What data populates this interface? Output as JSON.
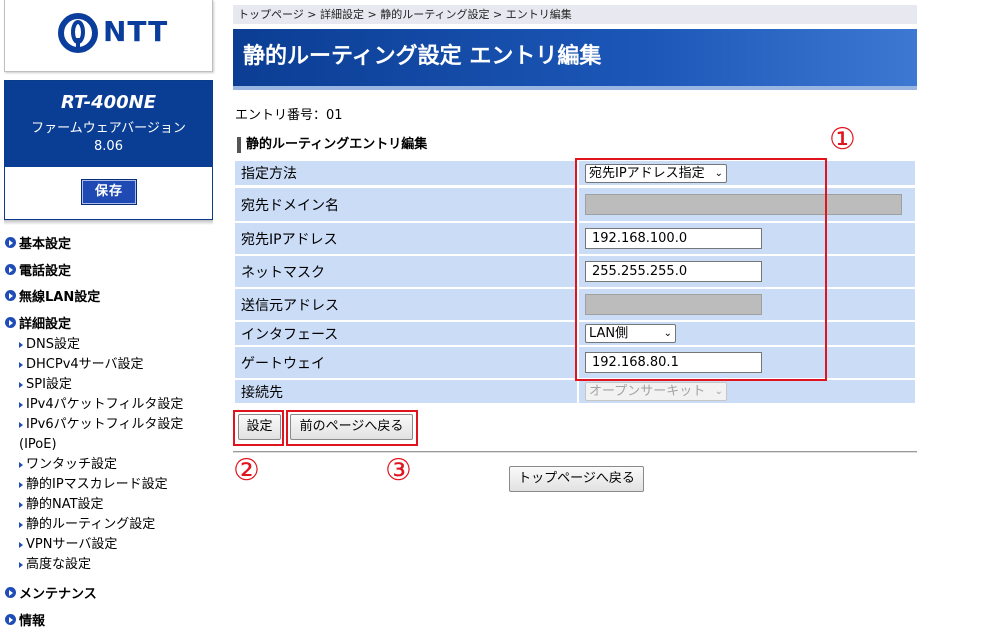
{
  "brand": {
    "logo_text": "NTT",
    "logo_icon": "ntt-logo-icon"
  },
  "device": {
    "model": "RT-400NE",
    "firmware_label": "ファームウェアバージョン",
    "firmware_version": "8.06",
    "save_label": "保存"
  },
  "nav": {
    "basic": "基本設定",
    "phone": "電話設定",
    "wlan": "無線LAN設定",
    "detail": "詳細設定",
    "sub": [
      "DNS設定",
      "DHCPv4サーバ設定",
      "SPI設定",
      "IPv4パケットフィルタ設定",
      "IPv6パケットフィルタ設定",
      "(IPoE)",
      "ワンタッチ設定",
      "静的IPマスカレード設定",
      "静的NAT設定",
      "静的ルーティング設定",
      "VPNサーバ設定",
      "高度な設定"
    ],
    "maintenance": "メンテナンス",
    "info": "情報"
  },
  "breadcrumb": "トップページ > 詳細設定 > 静的ルーティング設定 > エントリ編集",
  "page_title": "静的ルーティング設定 エントリ編集",
  "entry_number": "エントリ番号：01",
  "section_title": "静的ルーティングエントリ編集",
  "form": {
    "method_label": "指定方法",
    "method_value": "宛先IPアドレス指定",
    "domain_label": "宛先ドメイン名",
    "domain_value": "",
    "dest_ip_label": "宛先IPアドレス",
    "dest_ip_value": "192.168.100.0",
    "netmask_label": "ネットマスク",
    "netmask_value": "255.255.255.0",
    "src_label": "送信元アドレス",
    "src_value": "",
    "iface_label": "インタフェース",
    "iface_value": "LAN側",
    "gateway_label": "ゲートウェイ",
    "gateway_value": "192.168.80.1",
    "conn_label": "接続先",
    "conn_value": "オープンサーキット"
  },
  "buttons": {
    "set": "設定",
    "back": "前のページへ戻る",
    "top": "トップページへ戻る"
  },
  "annotations": {
    "one": "①",
    "two": "②",
    "three": "③",
    "color": "#e0141e"
  },
  "colors": {
    "brand_blue": "#0a3e95",
    "row_bg": "#cbdcf7"
  }
}
